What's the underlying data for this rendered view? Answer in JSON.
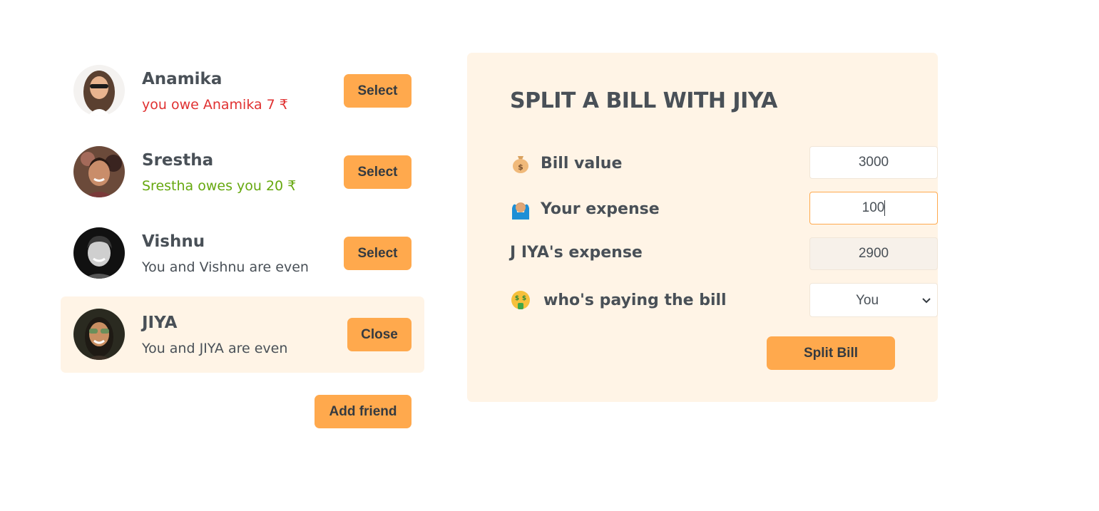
{
  "friends": [
    {
      "name": "Anamika",
      "status": "you owe Anamika 7 ₹",
      "status_color": "#e03131",
      "button": "Select",
      "selected": false
    },
    {
      "name": "Srestha",
      "status": "Srestha owes you 20 ₹",
      "status_color": "#66a80f",
      "button": "Select",
      "selected": false
    },
    {
      "name": "Vishnu",
      "status": "You and Vishnu are even",
      "status_color": "#495057",
      "button": "Select",
      "selected": false
    },
    {
      "name": "JIYA",
      "status": "You and JIYA are even",
      "status_color": "#495057",
      "button": "Close",
      "selected": true
    }
  ],
  "add_friend_label": "Add friend",
  "split": {
    "title": "SPLIT A BILL WITH JIYA",
    "bill_label": "Bill value",
    "bill_icon": "money-bag-icon",
    "bill_value": "3000",
    "expense_label": "Your expense",
    "expense_icon": "person-raising-hands-icon",
    "expense_value": "100",
    "friend_expense_label": "J IYA's expense",
    "friend_expense_value": "2900",
    "payer_label": "who's paying the bill",
    "payer_icon": "money-mouth-face-icon",
    "payer_value": "You",
    "submit_label": "Split Bill"
  },
  "colors": {
    "accent": "#ffa94d",
    "panel": "#fff4e6",
    "text": "#495057",
    "owe": "#e03131",
    "owed": "#66a80f"
  }
}
